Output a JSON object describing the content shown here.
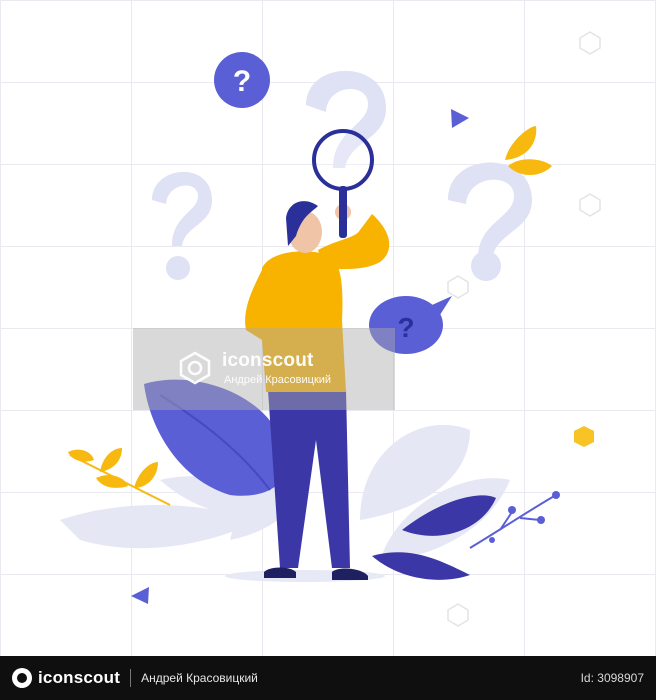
{
  "illustration": {
    "watermark_brand": "iconscout",
    "watermark_author": "Андрей Красовицкий",
    "speech_bubble_mark": "?",
    "colors": {
      "purple": "#5b5fd6",
      "navy": "#3b37a6",
      "lavender": "#dfe1f4",
      "yellow": "#f7b80f",
      "shirt": "#f7b300",
      "skin": "#f0c4a6",
      "hair": "#2b2f9a"
    }
  },
  "footer": {
    "brand": "iconscout",
    "author": "Андрей Красовицкий",
    "id_text": "Id: 3098907"
  }
}
